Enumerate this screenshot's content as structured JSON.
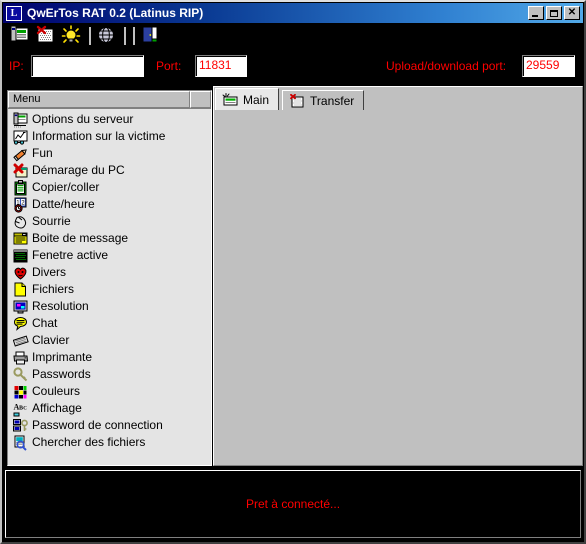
{
  "window": {
    "title": "QwErTos RAT 0.2 (Latinus RIP)",
    "icon": "L",
    "minimize_label": "–",
    "maximize_label": "□",
    "close_label": "✕",
    "accent_title_start": "#00006e",
    "accent_title_end": "#52a9e8"
  },
  "toolbar": {
    "items": [
      {
        "name": "server-options-icon",
        "tooltip": "Options du serveur"
      },
      {
        "name": "remove-list-icon",
        "tooltip": "Effacer"
      },
      {
        "name": "lightbulb-icon",
        "tooltip": "Info"
      },
      {
        "name": "globe-icon",
        "tooltip": "Connexion"
      },
      {
        "name": "exit-door-icon",
        "tooltip": "Quitter"
      }
    ]
  },
  "connection": {
    "ip_label": "IP:",
    "ip_value": "",
    "ip_placeholder": "",
    "port_label": "Port:",
    "port_value": "11831",
    "updown_label": "Upload/download port:",
    "updown_value": "29559",
    "label_color": "#ff0000",
    "value_color": "#ff0000"
  },
  "menu": {
    "header": "Menu",
    "header_extra": "",
    "items": [
      {
        "label": "Options du serveur",
        "icon": "server-options-icon"
      },
      {
        "label": "Information sur la victime",
        "icon": "victim-info-icon"
      },
      {
        "label": "Fun",
        "icon": "pencil-icon"
      },
      {
        "label": "Démarage du PC",
        "icon": "startup-icon"
      },
      {
        "label": "Copier/coller",
        "icon": "clipboard-icon"
      },
      {
        "label": "Datte/heure",
        "icon": "date-time-icon"
      },
      {
        "label": "Sourrie",
        "icon": "mouse-icon"
      },
      {
        "label": "Boite de message",
        "icon": "message-box-icon"
      },
      {
        "label": "Fenetre active",
        "icon": "active-window-icon"
      },
      {
        "label": "Divers",
        "icon": "heart-icon"
      },
      {
        "label": "Fichiers",
        "icon": "file-icon"
      },
      {
        "label": "Resolution",
        "icon": "monitor-icon"
      },
      {
        "label": "Chat",
        "icon": "chat-icon"
      },
      {
        "label": "Clavier",
        "icon": "keyboard-icon"
      },
      {
        "label": "Imprimante",
        "icon": "printer-icon"
      },
      {
        "label": "Passwords",
        "icon": "key-icon"
      },
      {
        "label": "Couleurs",
        "icon": "colors-icon"
      },
      {
        "label": "Affichage",
        "icon": "abc-icon"
      },
      {
        "label": "Password de connection",
        "icon": "network-password-icon"
      },
      {
        "label": "Chercher des fichiers",
        "icon": "search-files-icon"
      }
    ]
  },
  "tabs": [
    {
      "label": "Main",
      "icon": "main-tab-icon",
      "selected": true
    },
    {
      "label": "Transfer",
      "icon": "transfer-tab-icon",
      "selected": false
    }
  ],
  "status": {
    "text": "Pret à connecté...",
    "color": "#ff0000"
  }
}
